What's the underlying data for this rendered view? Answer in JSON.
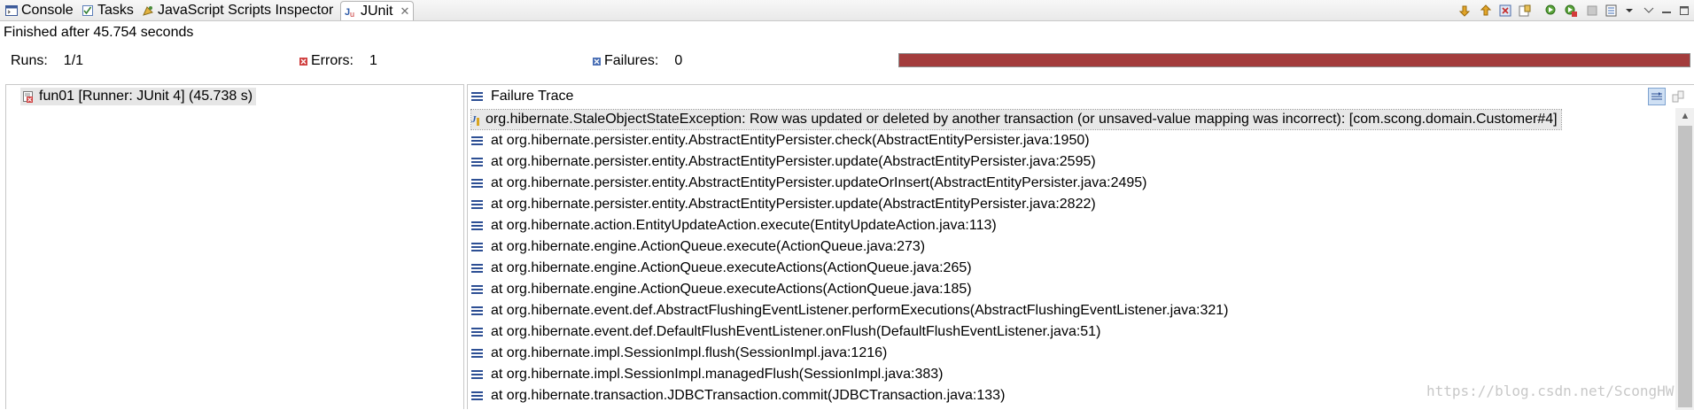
{
  "tabs": [
    {
      "label": "Console",
      "icon": "console-icon"
    },
    {
      "label": "Tasks",
      "icon": "tasks-icon"
    },
    {
      "label": "JavaScript Scripts Inspector",
      "icon": "scripts-inspector-icon"
    },
    {
      "label": "JUnit",
      "icon": "junit-icon",
      "active": true,
      "close": "✕"
    }
  ],
  "toolbar_icons": [
    "next-failure-icon",
    "previous-failure-icon",
    "show-failures-only-icon",
    "scroll-lock-icon",
    "rerun-test-icon",
    "rerun-failed-first-icon",
    "stop-icon",
    "test-run-history-icon",
    "view-menu-icon",
    "minimize-icon",
    "maximize-icon"
  ],
  "status": "Finished after 45.754 seconds",
  "counts": {
    "runs_label": "Runs:",
    "runs_value": "1/1",
    "errors_label": "Errors:",
    "errors_value": "1",
    "failures_label": "Failures:",
    "failures_value": "0"
  },
  "progress": {
    "fraction": 1.0,
    "color": "#a33c3c"
  },
  "test_tree": [
    {
      "label": "fun01 [Runner: JUnit 4] (45.738 s)",
      "icon": "test-error-icon"
    }
  ],
  "failure_trace": {
    "title": "Failure Trace",
    "exception": "org.hibernate.StaleObjectStateException: Row was updated or deleted by another transaction (or unsaved-value mapping was incorrect): [com.scong.domain.Customer#4]",
    "frames": [
      "at org.hibernate.persister.entity.AbstractEntityPersister.check(AbstractEntityPersister.java:1950)",
      "at org.hibernate.persister.entity.AbstractEntityPersister.update(AbstractEntityPersister.java:2595)",
      "at org.hibernate.persister.entity.AbstractEntityPersister.updateOrInsert(AbstractEntityPersister.java:2495)",
      "at org.hibernate.persister.entity.AbstractEntityPersister.update(AbstractEntityPersister.java:2822)",
      "at org.hibernate.action.EntityUpdateAction.execute(EntityUpdateAction.java:113)",
      "at org.hibernate.engine.ActionQueue.execute(ActionQueue.java:273)",
      "at org.hibernate.engine.ActionQueue.executeActions(ActionQueue.java:265)",
      "at org.hibernate.engine.ActionQueue.executeActions(ActionQueue.java:185)",
      "at org.hibernate.event.def.AbstractFlushingEventListener.performExecutions(AbstractFlushingEventListener.java:321)",
      "at org.hibernate.event.def.DefaultFlushEventListener.onFlush(DefaultFlushEventListener.java:51)",
      "at org.hibernate.impl.SessionImpl.flush(SessionImpl.java:1216)",
      "at org.hibernate.impl.SessionImpl.managedFlush(SessionImpl.java:383)",
      "at org.hibernate.transaction.JDBCTransaction.commit(JDBCTransaction.java:133)"
    ]
  },
  "watermark": "https://blog.csdn.net/ScongHW"
}
